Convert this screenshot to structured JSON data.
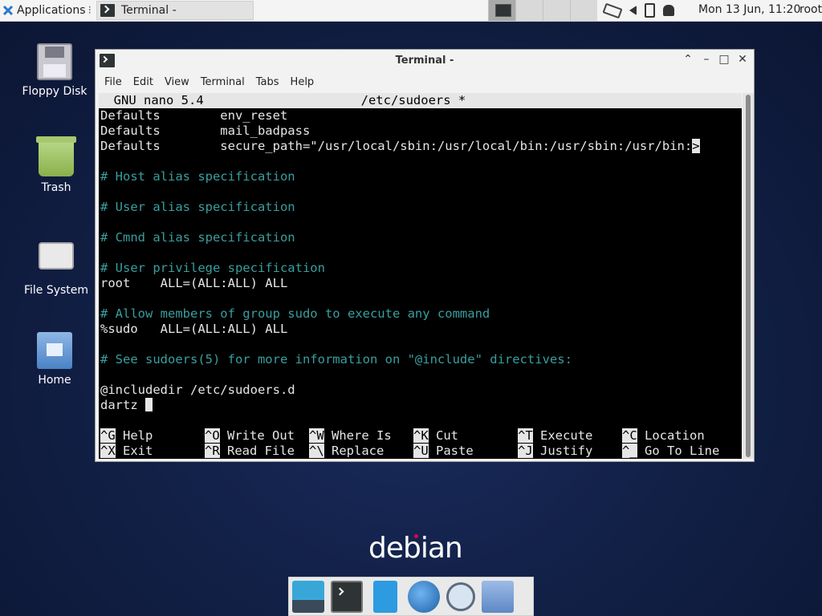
{
  "panel": {
    "applications_label": "Applications",
    "task_label": "Terminal -",
    "clock": "Mon 13 Jun, 11:20",
    "user": "root"
  },
  "desktop": {
    "icons": [
      {
        "label": "Floppy Disk"
      },
      {
        "label": "Trash"
      },
      {
        "label": "File System"
      },
      {
        "label": "Home"
      }
    ],
    "logo_text": "debian"
  },
  "window": {
    "title": "Terminal -",
    "menu": [
      "File",
      "Edit",
      "View",
      "Terminal",
      "Tabs",
      "Help"
    ]
  },
  "nano": {
    "header": "  GNU nano 5.4                     /etc/sudoers *",
    "lines": [
      {
        "text": "Defaults        env_reset",
        "type": "normal"
      },
      {
        "text": "Defaults        mail_badpass",
        "type": "normal"
      },
      {
        "text": "Defaults        secure_path=\"/usr/local/sbin:/usr/local/bin:/usr/sbin:/usr/bin:",
        "type": "normal",
        "overflow_marker": ">"
      },
      {
        "text": "",
        "type": "normal"
      },
      {
        "text": "# Host alias specification",
        "type": "comment"
      },
      {
        "text": "",
        "type": "normal"
      },
      {
        "text": "# User alias specification",
        "type": "comment"
      },
      {
        "text": "",
        "type": "normal"
      },
      {
        "text": "# Cmnd alias specification",
        "type": "comment"
      },
      {
        "text": "",
        "type": "normal"
      },
      {
        "text": "# User privilege specification",
        "type": "comment"
      },
      {
        "text": "root    ALL=(ALL:ALL) ALL",
        "type": "normal"
      },
      {
        "text": "",
        "type": "normal"
      },
      {
        "text": "# Allow members of group sudo to execute any command",
        "type": "comment"
      },
      {
        "text": "%sudo   ALL=(ALL:ALL) ALL",
        "type": "normal"
      },
      {
        "text": "",
        "type": "normal"
      },
      {
        "text": "# See sudoers(5) for more information on \"@include\" directives:",
        "type": "comment"
      },
      {
        "text": "",
        "type": "normal"
      },
      {
        "text": "@includedir /etc/sudoers.d",
        "type": "normal"
      },
      {
        "text": "dartz ",
        "type": "cursor"
      }
    ],
    "shortcuts_row1": [
      {
        "key": "^G",
        "label": "Help"
      },
      {
        "key": "^O",
        "label": "Write Out"
      },
      {
        "key": "^W",
        "label": "Where Is"
      },
      {
        "key": "^K",
        "label": "Cut"
      },
      {
        "key": "^T",
        "label": "Execute"
      },
      {
        "key": "^C",
        "label": "Location"
      }
    ],
    "shortcuts_row2": [
      {
        "key": "^X",
        "label": "Exit"
      },
      {
        "key": "^R",
        "label": "Read File"
      },
      {
        "key": "^\\",
        "label": "Replace"
      },
      {
        "key": "^U",
        "label": "Paste"
      },
      {
        "key": "^J",
        "label": "Justify"
      },
      {
        "key": "^_",
        "label": "Go To Line"
      }
    ]
  }
}
